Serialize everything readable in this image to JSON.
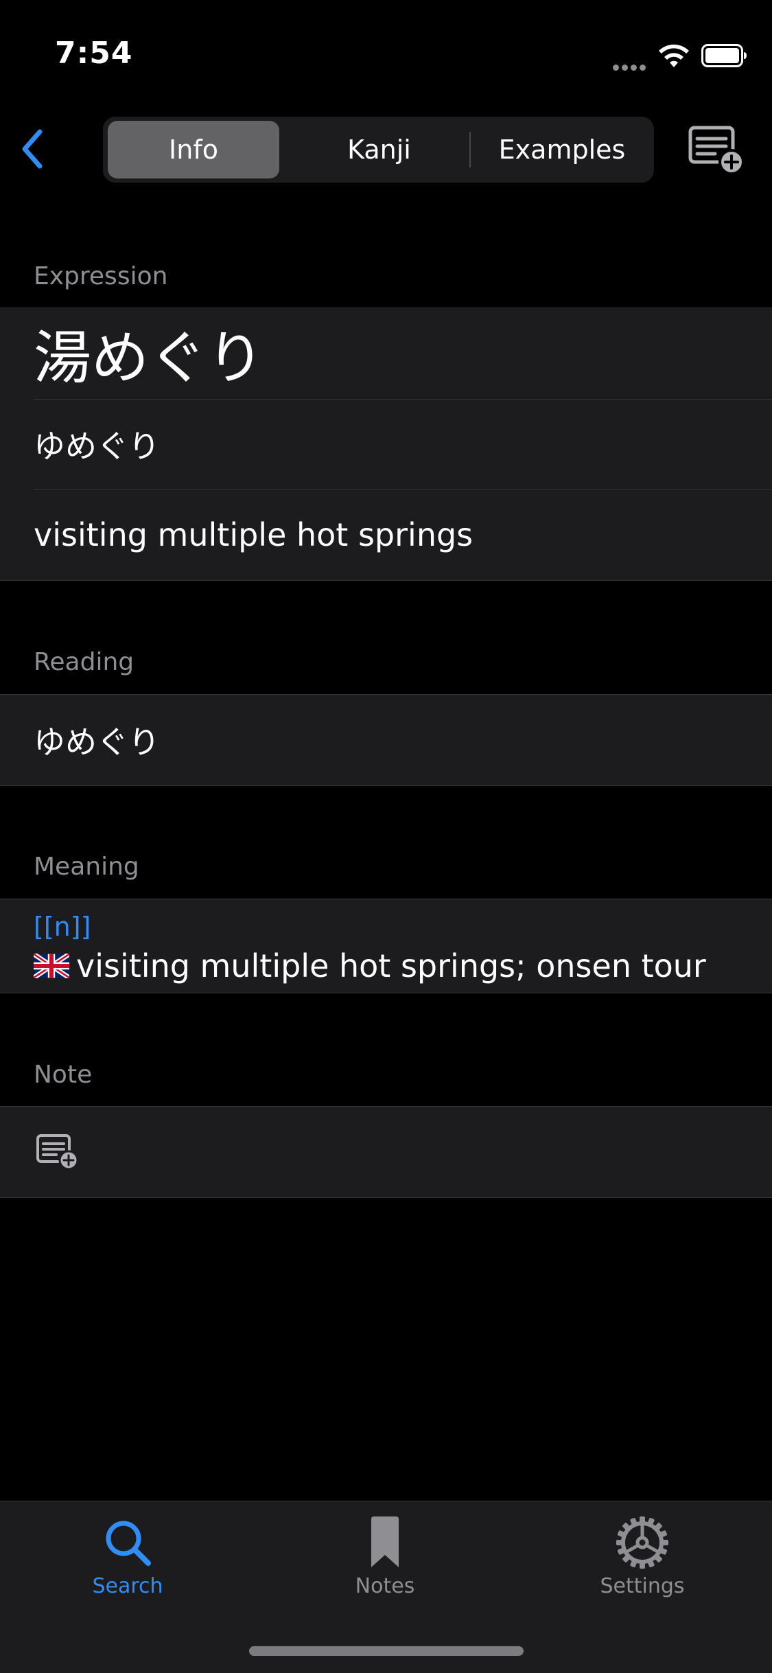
{
  "status_bar": {
    "time": "7:54"
  },
  "nav": {
    "back_icon": "chevron-left-icon",
    "segments": [
      {
        "label": "Info",
        "selected": true
      },
      {
        "label": "Kanji",
        "selected": false
      },
      {
        "label": "Examples",
        "selected": false
      }
    ],
    "add_note_icon": "note-add-icon"
  },
  "expression": {
    "header": "Expression",
    "kanji": "湯めぐり",
    "kana": "ゆめぐり",
    "gloss": "visiting multiple hot springs"
  },
  "reading": {
    "header": "Reading",
    "value": "ゆめぐり"
  },
  "meaning": {
    "header": "Meaning",
    "pos": "[[n]]",
    "flag_icon": "uk-flag-icon",
    "text": "visiting multiple hot springs; onsen tour"
  },
  "note": {
    "header": "Note",
    "add_icon": "note-add-icon"
  },
  "tab_bar": {
    "tabs": [
      {
        "label": "Search",
        "icon": "magnifier-icon",
        "selected": true
      },
      {
        "label": "Notes",
        "icon": "bookmark-icon",
        "selected": false
      },
      {
        "label": "Settings",
        "icon": "gear-icon",
        "selected": false
      }
    ]
  },
  "colors": {
    "accent": "#2f8df5",
    "background": "#000000",
    "cell_background": "#1c1c1e",
    "secondary_text": "#8e8e93"
  }
}
